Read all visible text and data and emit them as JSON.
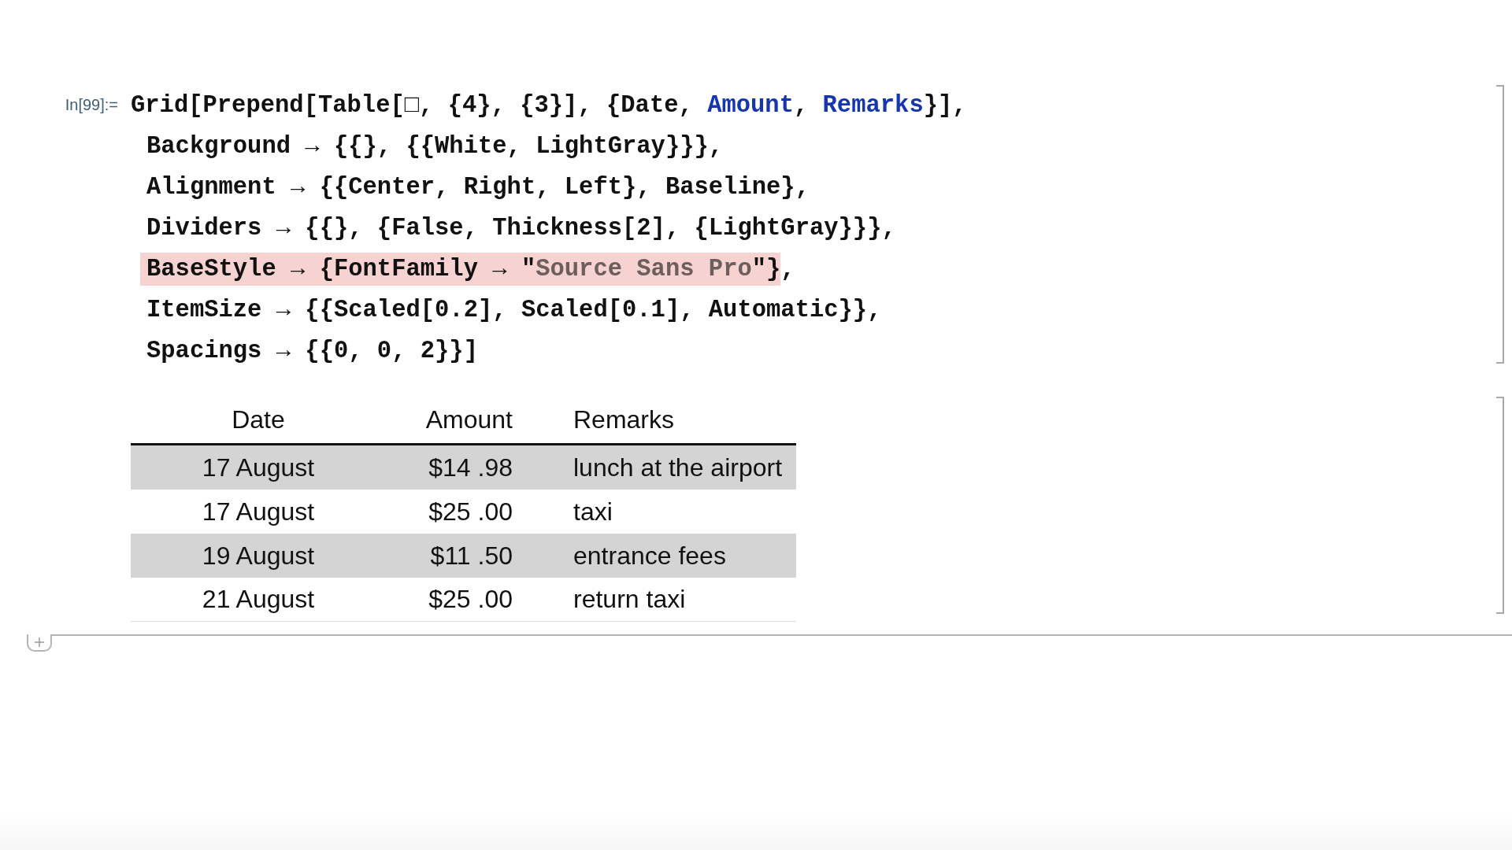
{
  "input_cell": {
    "label": "In[99]:=",
    "lines": [
      {
        "highlighted": false,
        "tokens": [
          {
            "kind": "plain",
            "text": "Grid[Prepend[Table[□, {4}, {3}], {Date, "
          },
          {
            "kind": "symbol",
            "text": "Amount"
          },
          {
            "kind": "plain",
            "text": ", "
          },
          {
            "kind": "symbol",
            "text": "Remarks"
          },
          {
            "kind": "plain",
            "text": "}],"
          }
        ]
      },
      {
        "highlighted": false,
        "tokens": [
          {
            "kind": "plain",
            "text": "Background → {{}, {{White, LightGray}}},"
          }
        ]
      },
      {
        "highlighted": false,
        "tokens": [
          {
            "kind": "plain",
            "text": "Alignment → {{Center, Right, Left}, Baseline},"
          }
        ]
      },
      {
        "highlighted": false,
        "tokens": [
          {
            "kind": "plain",
            "text": "Dividers → {{}, {False, Thickness[2], {LightGray}}},"
          }
        ]
      },
      {
        "highlighted": true,
        "tokens": [
          {
            "kind": "plain",
            "text": "BaseStyle → {FontFamily → \""
          },
          {
            "kind": "string",
            "text": "Source Sans Pro"
          },
          {
            "kind": "plain",
            "text": "\"}"
          }
        ],
        "tail": ","
      },
      {
        "highlighted": false,
        "tokens": [
          {
            "kind": "plain",
            "text": "ItemSize → {{Scaled[0.2], Scaled[0.1], Automatic}},"
          }
        ]
      },
      {
        "highlighted": false,
        "tokens": [
          {
            "kind": "plain",
            "text": "Spacings → {{0, 0, 2}}]"
          }
        ]
      }
    ]
  },
  "output_table": {
    "columns": [
      "Date",
      "Amount",
      "Remarks"
    ],
    "rows": [
      {
        "shaded": true,
        "cells": [
          "17 August",
          "$14 .98",
          "lunch at the airport"
        ]
      },
      {
        "shaded": false,
        "cells": [
          "17 August",
          "$25 .00",
          "taxi"
        ]
      },
      {
        "shaded": true,
        "cells": [
          "19 August",
          "$11 .50",
          "entrance fees"
        ]
      },
      {
        "shaded": false,
        "cells": [
          "21 August",
          "$25 .00",
          "return taxi"
        ]
      }
    ]
  }
}
